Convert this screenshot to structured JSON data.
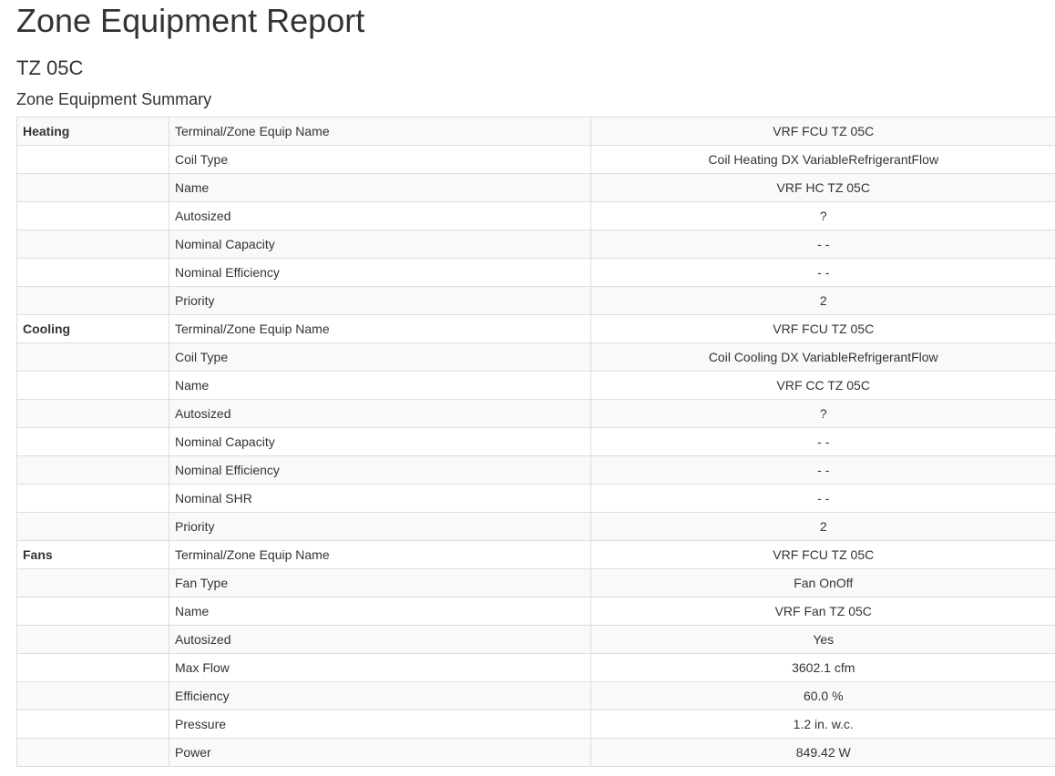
{
  "page": {
    "title": "Zone Equipment Report",
    "zone": "TZ 05C",
    "section": "Zone Equipment Summary"
  },
  "table": {
    "rows": [
      {
        "group": "Heating",
        "property": "Terminal/Zone Equip Name",
        "value": "VRF FCU TZ 05C"
      },
      {
        "group": "",
        "property": "Coil Type",
        "value": "Coil Heating DX VariableRefrigerantFlow"
      },
      {
        "group": "",
        "property": "Name",
        "value": "VRF HC TZ 05C"
      },
      {
        "group": "",
        "property": "Autosized",
        "value": "?"
      },
      {
        "group": "",
        "property": "Nominal Capacity",
        "value": "- -"
      },
      {
        "group": "",
        "property": "Nominal Efficiency",
        "value": "- -"
      },
      {
        "group": "",
        "property": "Priority",
        "value": "2"
      },
      {
        "group": "Cooling",
        "property": "Terminal/Zone Equip Name",
        "value": "VRF FCU TZ 05C"
      },
      {
        "group": "",
        "property": "Coil Type",
        "value": "Coil Cooling DX VariableRefrigerantFlow"
      },
      {
        "group": "",
        "property": "Name",
        "value": "VRF CC TZ 05C"
      },
      {
        "group": "",
        "property": "Autosized",
        "value": "?"
      },
      {
        "group": "",
        "property": "Nominal Capacity",
        "value": "- -"
      },
      {
        "group": "",
        "property": "Nominal Efficiency",
        "value": "- -"
      },
      {
        "group": "",
        "property": "Nominal SHR",
        "value": "- -"
      },
      {
        "group": "",
        "property": "Priority",
        "value": "2"
      },
      {
        "group": "Fans",
        "property": "Terminal/Zone Equip Name",
        "value": "VRF FCU TZ 05C"
      },
      {
        "group": "",
        "property": "Fan Type",
        "value": "Fan OnOff"
      },
      {
        "group": "",
        "property": "Name",
        "value": "VRF Fan TZ 05C"
      },
      {
        "group": "",
        "property": "Autosized",
        "value": "Yes"
      },
      {
        "group": "",
        "property": "Max Flow",
        "value": "3602.1 cfm"
      },
      {
        "group": "",
        "property": "Efficiency",
        "value": "60.0 %"
      },
      {
        "group": "",
        "property": "Pressure",
        "value": "1.2 in. w.c."
      },
      {
        "group": "",
        "property": "Power",
        "value": "849.42 W"
      }
    ]
  }
}
